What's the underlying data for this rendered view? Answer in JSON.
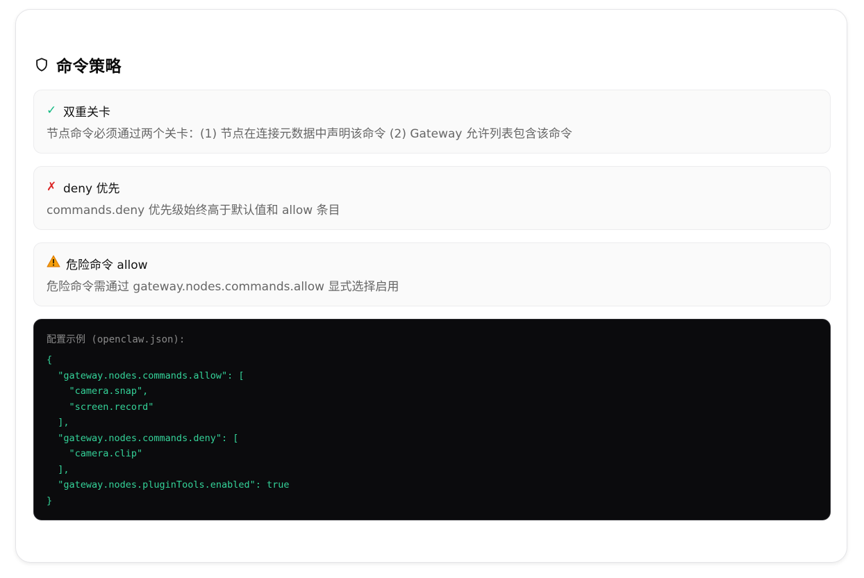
{
  "section": {
    "title": "命令策略",
    "icon": "shield-icon"
  },
  "rules": [
    {
      "icon": "check-icon",
      "icon_glyph": "✓",
      "icon_color": "#10b981",
      "title": "双重关卡",
      "description": "节点命令必须通过两个关卡：(1) 节点在连接元数据中声明该命令 (2) Gateway 允许列表包含该命令"
    },
    {
      "icon": "cross-icon",
      "icon_glyph": "✗",
      "icon_color": "#dc2626",
      "title": "deny 优先",
      "description": "commands.deny 优先级始终高于默认值和 allow 条目"
    },
    {
      "icon": "warning-icon",
      "icon_glyph": "⚠",
      "icon_color": "#f59e0b",
      "title": "危险命令 allow",
      "description": "危险命令需通过 gateway.nodes.commands.allow 显式选择启用"
    }
  ],
  "code_block": {
    "caption": "配置示例 (openclaw.json):",
    "lines": [
      "{",
      "  \"gateway.nodes.commands.allow\": [",
      "    \"camera.snap\",",
      "    \"screen.record\"",
      "  ],",
      "  \"gateway.nodes.commands.deny\": [",
      "    \"camera.clip\"",
      "  ],",
      "  \"gateway.nodes.pluginTools.enabled\": true",
      "}"
    ],
    "text_color": "#34d399",
    "background": "#0b0b0d"
  }
}
